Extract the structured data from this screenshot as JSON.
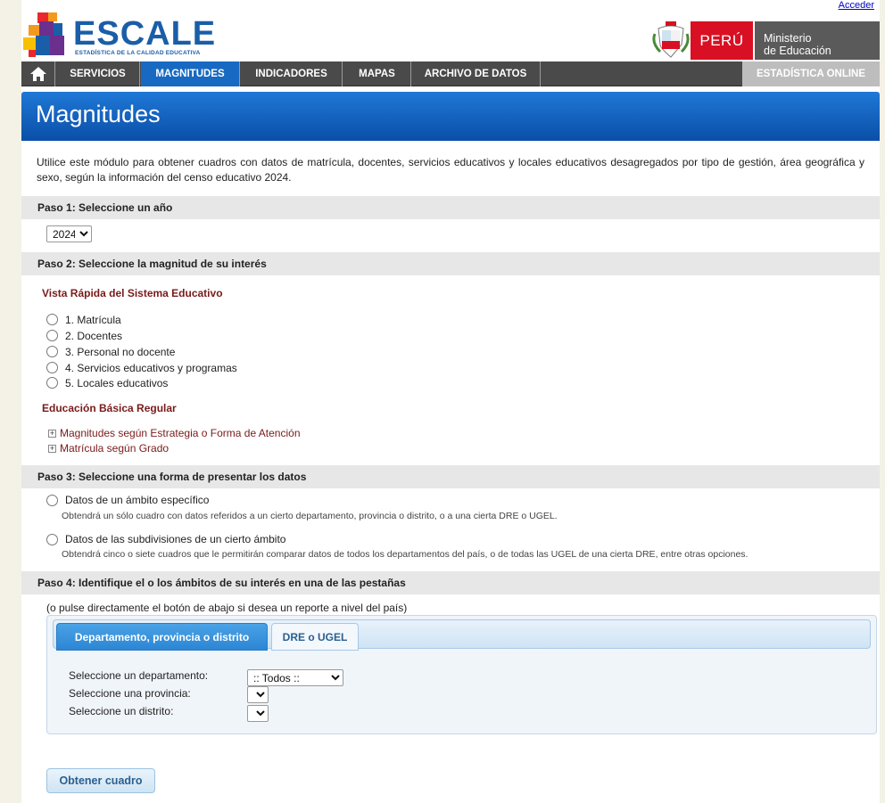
{
  "header": {
    "login_link": "Acceder",
    "logo_text": "ESCALE",
    "logo_subtitle": "ESTADÍSTICA DE LA CALIDAD EDUCATIVA",
    "country": "PERÚ",
    "ministry_line1": "Ministerio",
    "ministry_line2": "de Educación"
  },
  "nav": {
    "items": [
      {
        "label": "SERVICIOS"
      },
      {
        "label": "MAGNITUDES"
      },
      {
        "label": "INDICADORES"
      },
      {
        "label": "MAPAS"
      },
      {
        "label": "ARCHIVO DE DATOS"
      }
    ],
    "online_label": "ESTADÍSTICA ONLINE"
  },
  "page": {
    "title": "Magnitudes",
    "intro": "Utilice este módulo para obtener cuadros con datos de matrícula, docentes, servicios educativos y locales educativos desagregados por tipo de gestión, área geográfica y sexo, según la información del censo educativo 2024."
  },
  "step1": {
    "title": "Paso 1: Seleccione un año",
    "year_selected": "2024"
  },
  "step2": {
    "title": "Paso 2: Seleccione la magnitud de su interés",
    "quick_view_title": "Vista Rápida del Sistema Educativo",
    "quick_options": [
      "1. Matrícula",
      "2. Docentes",
      "3. Personal no docente",
      "4. Servicios educativos y programas",
      "5. Locales educativos"
    ],
    "ebr_title": "Educación Básica Regular",
    "ebr_items": [
      "Magnitudes según Estrategia o Forma de Atención",
      "Matrícula según Grado"
    ]
  },
  "step3": {
    "title": "Paso 3: Seleccione una forma de presentar los datos",
    "option1_label": "Datos de un ámbito específico",
    "option1_desc": "Obtendrá un sólo cuadro con datos referidos a un cierto departamento, provincia o distrito, o a una cierta DRE o UGEL.",
    "option2_label": "Datos de las subdivisiones de un cierto ámbito",
    "option2_desc": "Obtendrá cinco o siete cuadros que le permitirán comparar datos de todos los departamentos del país, o de todas las UGEL de una cierta DRE, entre otras opciones."
  },
  "step4": {
    "title": "Paso 4: Identifique el o los ámbitos de su interés en una de las pestañas",
    "hint": "(o pulse directamente el botón de abajo si desea un reporte a nivel del país)",
    "tab_active": "Departamento, provincia o distrito",
    "tab_inactive": "DRE o UGEL",
    "dept_label": "Seleccione un departamento:",
    "dept_value": ":: Todos ::",
    "prov_label": "Seleccione una provincia:",
    "dist_label": "Seleccione un distrito:",
    "submit_label": "Obtener cuadro"
  }
}
